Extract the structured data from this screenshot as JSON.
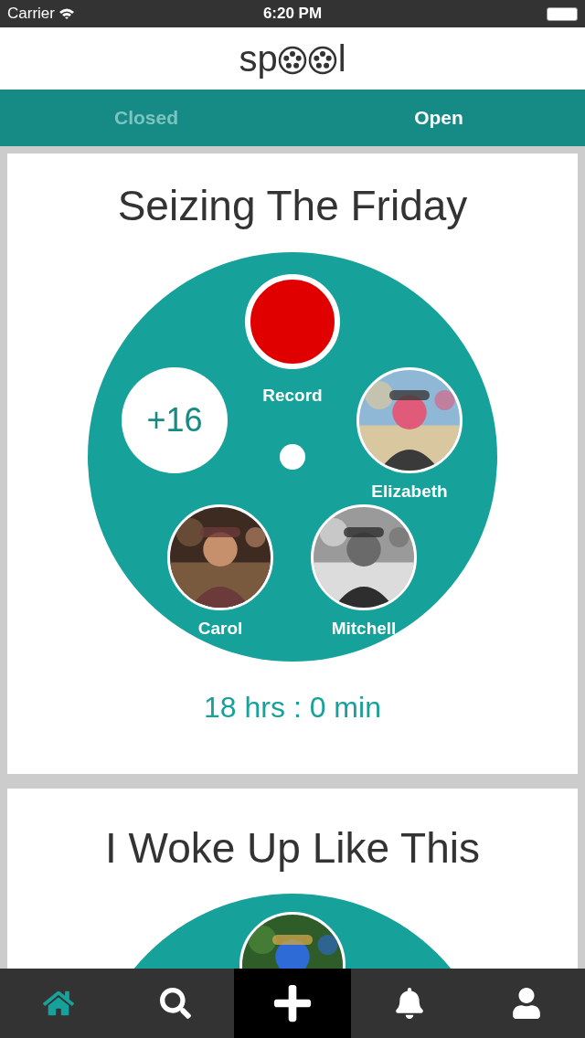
{
  "status_bar": {
    "carrier": "Carrier",
    "time": "6:20 PM"
  },
  "logo": {
    "text_start": "sp",
    "text_end": "l"
  },
  "tabs": [
    {
      "label": "Closed",
      "selected": false
    },
    {
      "label": "Open",
      "selected": true
    }
  ],
  "spools": [
    {
      "kind": "full",
      "title": "Seizing The Friday",
      "record_label": "Record",
      "extra_count": "+16",
      "members": [
        {
          "name": "Elizabeth"
        },
        {
          "name": "Carol"
        },
        {
          "name": "Mitchell"
        }
      ],
      "time_left": "18 hrs : 0 min"
    },
    {
      "kind": "preview",
      "title": "I Woke Up Like This"
    }
  ],
  "nav": [
    {
      "kind": "home",
      "selected": true
    },
    {
      "kind": "search",
      "selected": false
    },
    {
      "kind": "add",
      "selected": false
    },
    {
      "kind": "notifications",
      "selected": false
    },
    {
      "kind": "profile",
      "selected": false
    }
  ]
}
